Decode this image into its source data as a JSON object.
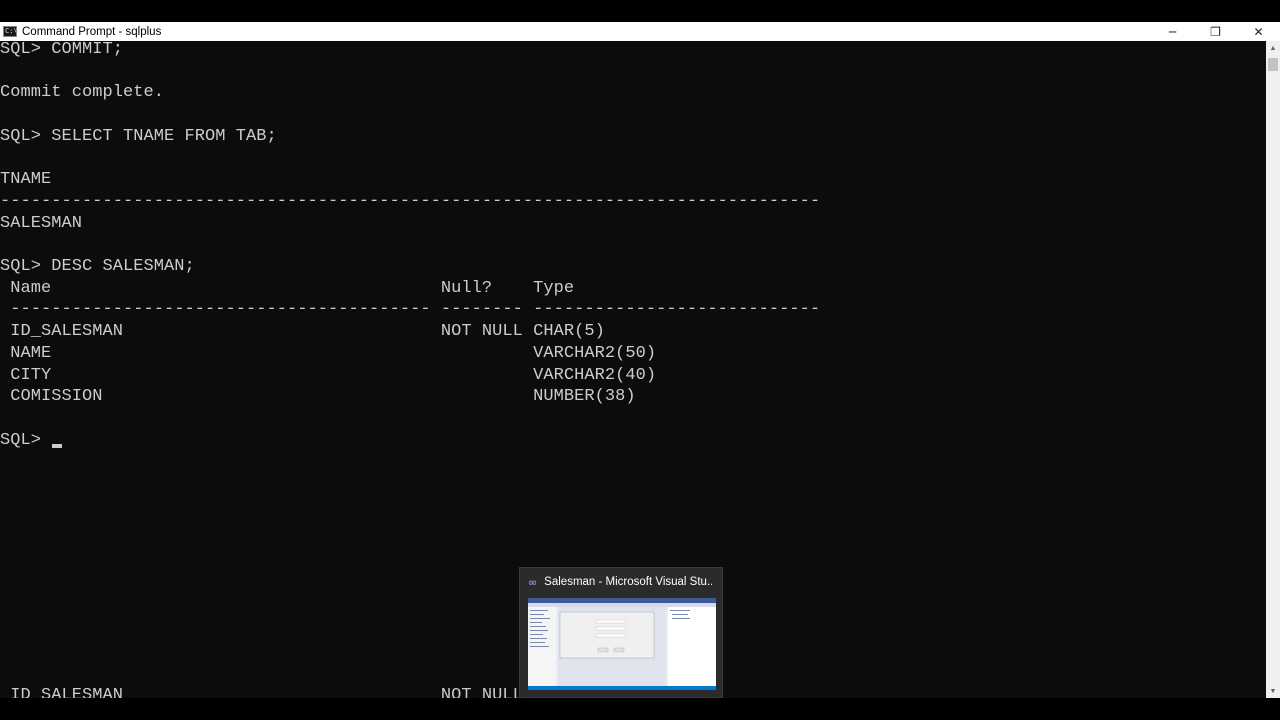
{
  "window": {
    "title": "Command Prompt - sqlplus",
    "minimize_glyph": "─",
    "maximize_glyph": "❐",
    "close_glyph": "✕"
  },
  "console": {
    "lines": [
      "SQL> COMMIT;",
      "",
      "Commit complete.",
      "",
      "SQL> SELECT TNAME FROM TAB;",
      "",
      "TNAME",
      "--------------------------------------------------------------------------------",
      "SALESMAN",
      "",
      "SQL> DESC SALESMAN;",
      " Name                                      Null?    Type",
      " ----------------------------------------- -------- ----------------------------",
      " ID_SALESMAN                               NOT NULL CHAR(5)",
      " NAME                                               VARCHAR2(50)",
      " CITY                                               VARCHAR2(40)",
      " COMISSION                                          NUMBER(38)",
      "",
      "SQL> "
    ],
    "partial_bottom_line": " ID_SALESMAN                               NOT NULL"
  },
  "taskbar_preview": {
    "title": "Salesman - Microsoft Visual Stu...",
    "icon": "visual-studio-icon"
  },
  "colors": {
    "console_bg": "#0c0c0c",
    "console_fg": "#cccccc",
    "titlebar_bg": "#ffffff",
    "scrollbar_bg": "#f0f0f0",
    "preview_bg": "#2b2b2b"
  }
}
